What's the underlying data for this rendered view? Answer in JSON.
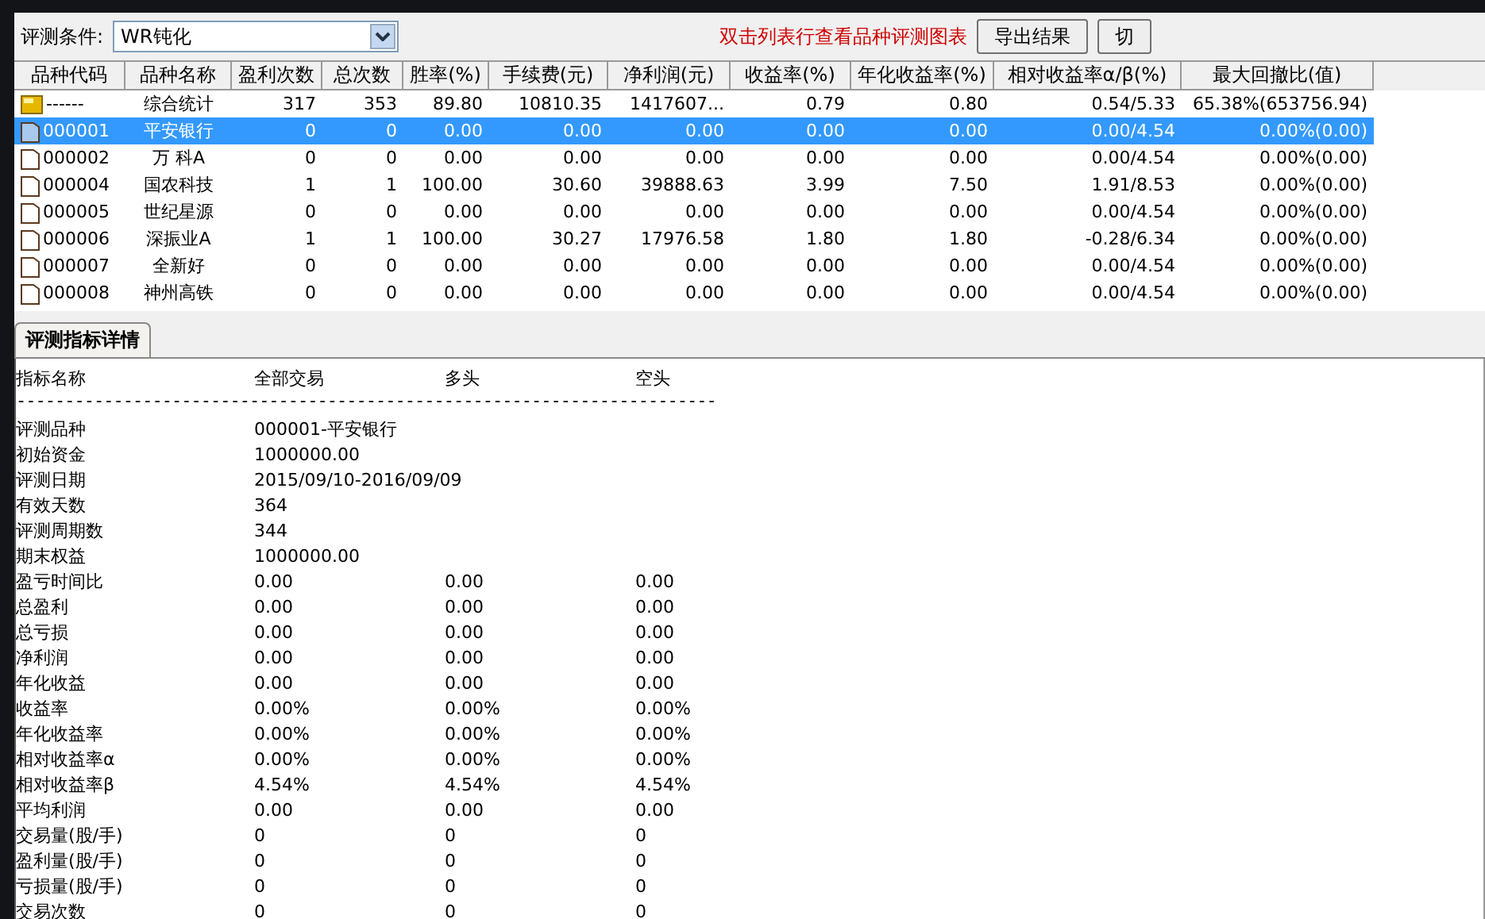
{
  "filter": {
    "label": "评测条件:",
    "value": "WR钝化"
  },
  "hint": "双击列表行查看品种评测图表",
  "buttons": [
    "导出结果",
    "切"
  ],
  "table": {
    "columns": [
      "品种代码",
      "品种名称",
      "盈利次数",
      "总次数",
      "胜率(%)",
      "手续费(元)",
      "净利润(元)",
      "收益率(%)",
      "年化收益率(%)",
      "相对收益率α/β(%)",
      "最大回撤比(值)"
    ],
    "rows": [
      {
        "kind": "summary",
        "selected": false,
        "cells": [
          "------",
          "综合统计",
          "317",
          "353",
          "89.80",
          "10810.35",
          "1417607...",
          "0.79",
          "0.80",
          "0.54/5.33",
          "65.38%(653756.94)"
        ]
      },
      {
        "kind": "stock",
        "selected": true,
        "cells": [
          "000001",
          "平安银行",
          "0",
          "0",
          "0.00",
          "0.00",
          "0.00",
          "0.00",
          "0.00",
          "0.00/4.54",
          "0.00%(0.00)"
        ]
      },
      {
        "kind": "stock",
        "selected": false,
        "cells": [
          "000002",
          "万 科A",
          "0",
          "0",
          "0.00",
          "0.00",
          "0.00",
          "0.00",
          "0.00",
          "0.00/4.54",
          "0.00%(0.00)"
        ]
      },
      {
        "kind": "stock",
        "selected": false,
        "cells": [
          "000004",
          "国农科技",
          "1",
          "1",
          "100.00",
          "30.60",
          "39888.63",
          "3.99",
          "7.50",
          "1.91/8.53",
          "0.00%(0.00)"
        ]
      },
      {
        "kind": "stock",
        "selected": false,
        "cells": [
          "000005",
          "世纪星源",
          "0",
          "0",
          "0.00",
          "0.00",
          "0.00",
          "0.00",
          "0.00",
          "0.00/4.54",
          "0.00%(0.00)"
        ]
      },
      {
        "kind": "stock",
        "selected": false,
        "cells": [
          "000006",
          "深振业A",
          "1",
          "1",
          "100.00",
          "30.27",
          "17976.58",
          "1.80",
          "1.80",
          "-0.28/6.34",
          "0.00%(0.00)"
        ]
      },
      {
        "kind": "stock",
        "selected": false,
        "cells": [
          "000007",
          "全新好",
          "0",
          "0",
          "0.00",
          "0.00",
          "0.00",
          "0.00",
          "0.00",
          "0.00/4.54",
          "0.00%(0.00)"
        ]
      },
      {
        "kind": "stock",
        "selected": false,
        "cells": [
          "000008",
          "神州高铁",
          "0",
          "0",
          "0.00",
          "0.00",
          "0.00",
          "0.00",
          "0.00",
          "0.00/4.54",
          "0.00%(0.00)"
        ]
      }
    ]
  },
  "detail_tab": {
    "label": "评测指标详情"
  },
  "detail": {
    "columns": [
      "指标名称",
      "全部交易",
      "多头",
      "空头"
    ],
    "separator": "------------------------------------------------------------------------",
    "rows": [
      [
        "评测品种",
        "000001-平安银行"
      ],
      [
        "初始资金",
        "1000000.00"
      ],
      [
        "评测日期",
        "2015/09/10-2016/09/09"
      ],
      [
        "有效天数",
        "364"
      ],
      [
        "评测周期数",
        "344"
      ],
      [
        "期末权益",
        "1000000.00"
      ],
      [
        "盈亏时间比",
        "0.00",
        "0.00",
        "0.00"
      ],
      [
        "总盈利",
        "0.00",
        "0.00",
        "0.00"
      ],
      [
        "总亏损",
        "0.00",
        "0.00",
        "0.00"
      ],
      [
        "净利润",
        "0.00",
        "0.00",
        "0.00"
      ],
      [
        "年化收益",
        "0.00",
        "0.00",
        "0.00"
      ],
      [
        "收益率",
        "0.00%",
        "0.00%",
        "0.00%"
      ],
      [
        "年化收益率",
        "0.00%",
        "0.00%",
        "0.00%"
      ],
      [
        "相对收益率α",
        "0.00%",
        "0.00%",
        "0.00%"
      ],
      [
        "相对收益率β",
        "4.54%",
        "4.54%",
        "4.54%"
      ],
      [
        "平均利润",
        "0.00",
        "0.00",
        "0.00"
      ],
      [
        "交易量(股/手)",
        "0",
        "0",
        "0"
      ],
      [
        "盈利量(股/手)",
        "0",
        "0",
        "0"
      ],
      [
        "亏损量(股/手)",
        "0",
        "0",
        "0"
      ],
      [
        "交易次数",
        "0",
        "0",
        "0"
      ]
    ]
  }
}
